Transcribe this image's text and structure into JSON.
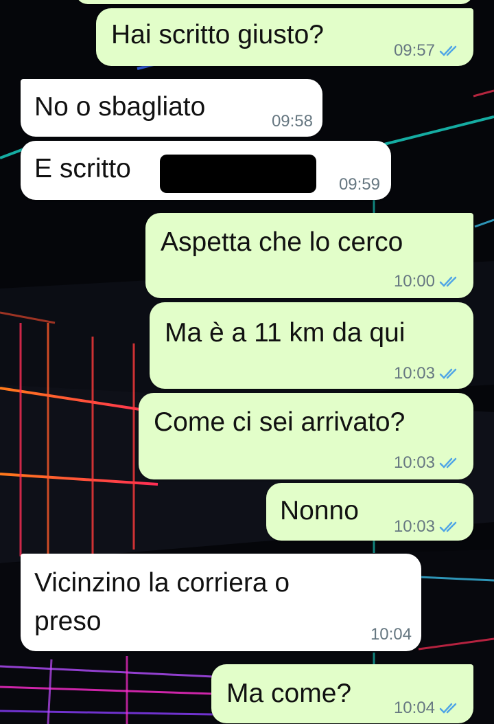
{
  "chat": {
    "messages": [
      {
        "direction": "outgoing",
        "text": "Hai scritto giusto?",
        "time": "09:57",
        "read": true
      },
      {
        "direction": "incoming",
        "text": "No o sbagliato",
        "time": "09:58"
      },
      {
        "direction": "incoming",
        "text": "E scritto",
        "time": "09:59",
        "redacted": true
      },
      {
        "direction": "outgoing",
        "text": "Aspetta che lo cerco",
        "time": "10:00",
        "read": true
      },
      {
        "direction": "outgoing",
        "text": "Ma è a 11 km da qui",
        "time": "10:03",
        "read": true
      },
      {
        "direction": "outgoing",
        "text": "Come ci sei arrivato?",
        "time": "10:03",
        "read": true
      },
      {
        "direction": "outgoing",
        "text": "Nonno",
        "time": "10:03",
        "read": true
      },
      {
        "direction": "incoming",
        "text_line1": "Vicinzino la corriera o",
        "text_line2": "preso",
        "time": "10:04"
      },
      {
        "direction": "outgoing",
        "text": "Ma come?",
        "time": "10:04",
        "read": true
      }
    ]
  },
  "colors": {
    "outgoing_bubble": "#e2fec9",
    "incoming_bubble": "#ffffff",
    "read_ticks": "#4fa5e6",
    "timestamp": "#667781",
    "wallpaper": "#05060a"
  },
  "icons": {
    "read_receipt": "double-check-icon"
  }
}
